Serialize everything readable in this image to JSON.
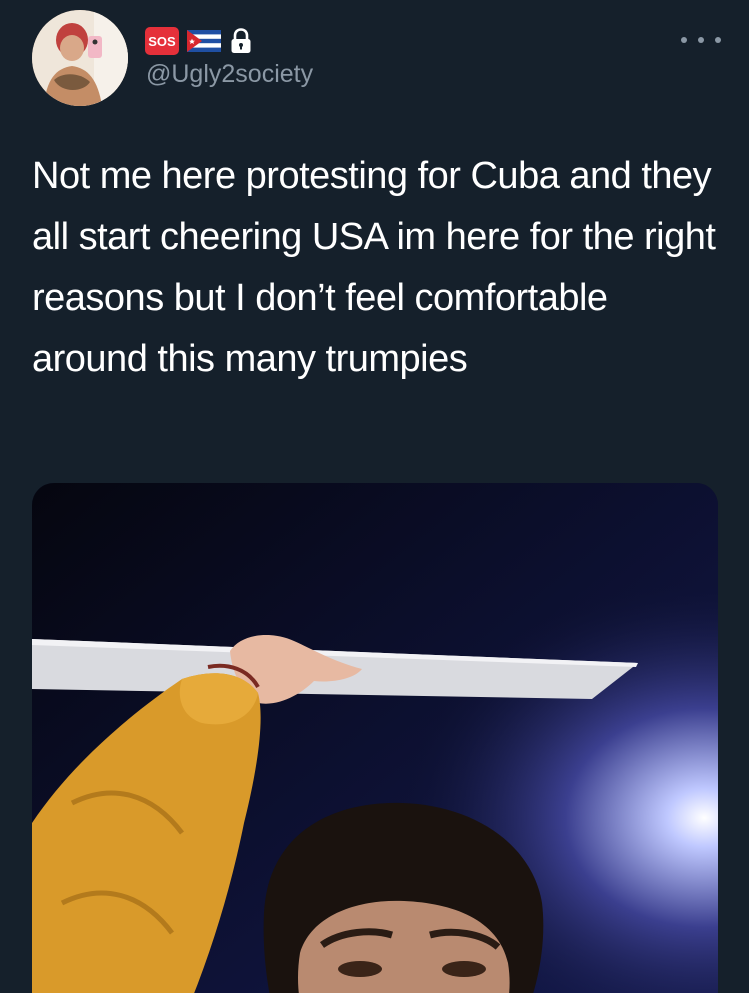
{
  "tweet": {
    "author": {
      "handle": "@Ugly2society",
      "badges": [
        {
          "type": "emoji",
          "label": "SOS",
          "icon": "sos-icon",
          "color": "#e5303a"
        },
        {
          "type": "emoji",
          "icon": "cuba-flag-icon"
        },
        {
          "type": "icon",
          "icon": "lock-icon"
        }
      ]
    },
    "text": "Not me here protesting for Cuba and they all start cheering USA im here for the right reasons but I don’t feel comfortable around this many trumpies",
    "more_icon": "more-horizontal-icon",
    "media": {
      "kind": "photo"
    }
  },
  "theme": {
    "background": "#15202b",
    "text": "#ffffff",
    "secondary_text": "#8b98a5"
  }
}
